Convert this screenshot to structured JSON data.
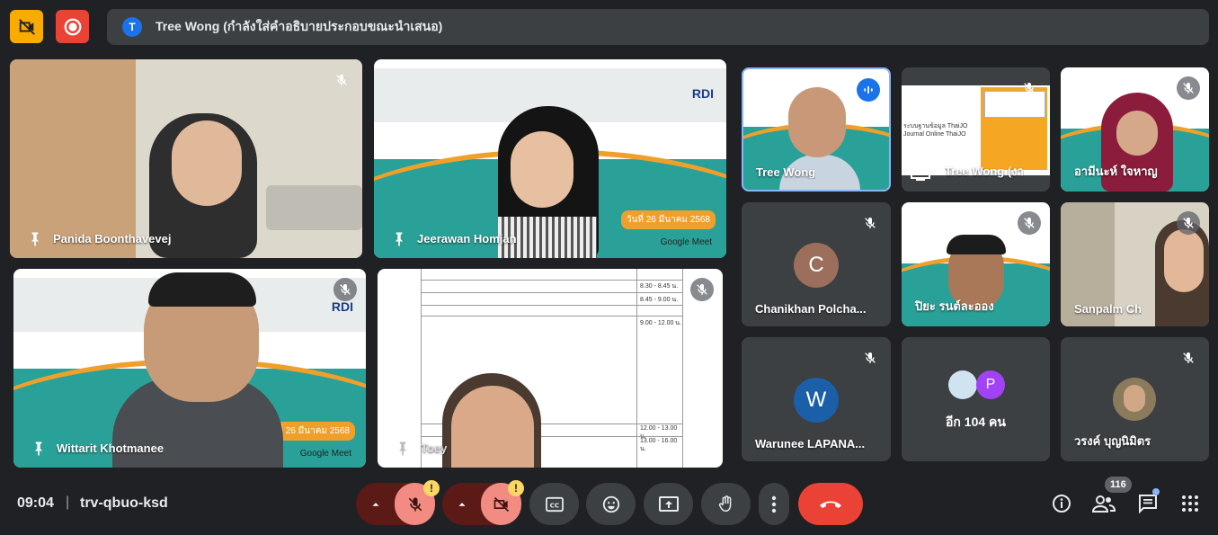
{
  "presenting_banner": {
    "initial": "T",
    "text": "Tree Wong (กำลังใส่คำอธิบายประกอบขณะนำเสนอ)"
  },
  "tiles": {
    "panida": "Panida Boonthavevej",
    "jeerawan": "Jeerawan Homjan",
    "wittarit": "Wittarit Khotmanee",
    "toey": "Toey",
    "tree_wong": "Tree Wong",
    "tree_wong_screen": "Tree Wong (งา",
    "aminah": "อามีนะห์ ใจหาญ",
    "chanikhan": "Chanikhan Polcha...",
    "chanikhan_initial": "C",
    "piya": "ปิยะ รนต์ละออง",
    "sanpalm": "Sanpalm Ch",
    "warunee": "Warunee LAPANA...",
    "warunee_initial": "W",
    "more_label": "อีก 104 คน",
    "more_initial": "P",
    "worawong": "วรงค์ บุญนิมิตร"
  },
  "slide_text": {
    "rdi": "RDI",
    "google_meet": "Google Meet",
    "date": "วันที่ 26 มีนาคม 2568",
    "thaijo": "ระบบฐานข้อมูล ThaiJO Journal Online ThaiJO"
  },
  "schedule_times": [
    "8.30 - 8.45 น.",
    "8.45 - 9.00 น.",
    "9.00 - 12.00 น.",
    "12.00 - 13.00 น.",
    "13.00 - 16.00 น."
  ],
  "bottom": {
    "time": "09:04",
    "separator": "|",
    "meeting_code": "trv-qbuo-ksd",
    "warning_mark": "!",
    "people_count": "116"
  },
  "colors": {
    "red": "#ea4335",
    "yellow": "#f9ab00",
    "accent_blue": "#8ab4f8"
  }
}
